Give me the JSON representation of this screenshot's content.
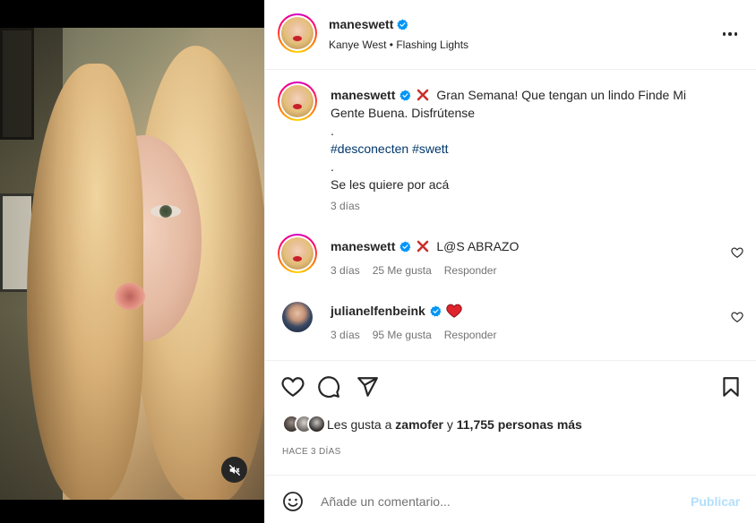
{
  "header": {
    "username": "maneswett",
    "audio": "Kanye West • Flashing Lights"
  },
  "caption": {
    "username": "maneswett",
    "line1_prefix": "Gran Semana! Que tengan un lindo Finde Mi",
    "line2": "Gente Buena. Disfrútense",
    "dot1": ".",
    "hashtag1": "#desconecten",
    "hashtag2": "#swett",
    "dot2": ".",
    "line_last": "Se les quiere por acá",
    "time": "3 días"
  },
  "comments": [
    {
      "username": "maneswett",
      "text": "L@S ABRAZO",
      "time": "3 días",
      "likes": "25 Me gusta",
      "reply": "Responder"
    },
    {
      "username": "julianelfenbeink",
      "text": "",
      "time": "3 días",
      "likes": "95 Me gusta",
      "reply": "Responder"
    }
  ],
  "likes": {
    "prefix": "Les gusta a",
    "user": "zamofer",
    "middle": "y",
    "count": "11,755 personas más"
  },
  "post_date": "HACE 3 DÍAS",
  "composer": {
    "placeholder": "Añade un comentario...",
    "publish": "Publicar"
  },
  "colors": {
    "link": "#00376b",
    "meta": "#737373",
    "publish_disabled": "#b2dffc",
    "heart_emoji": "#e0242e",
    "cross_emoji": "#c9302c"
  }
}
